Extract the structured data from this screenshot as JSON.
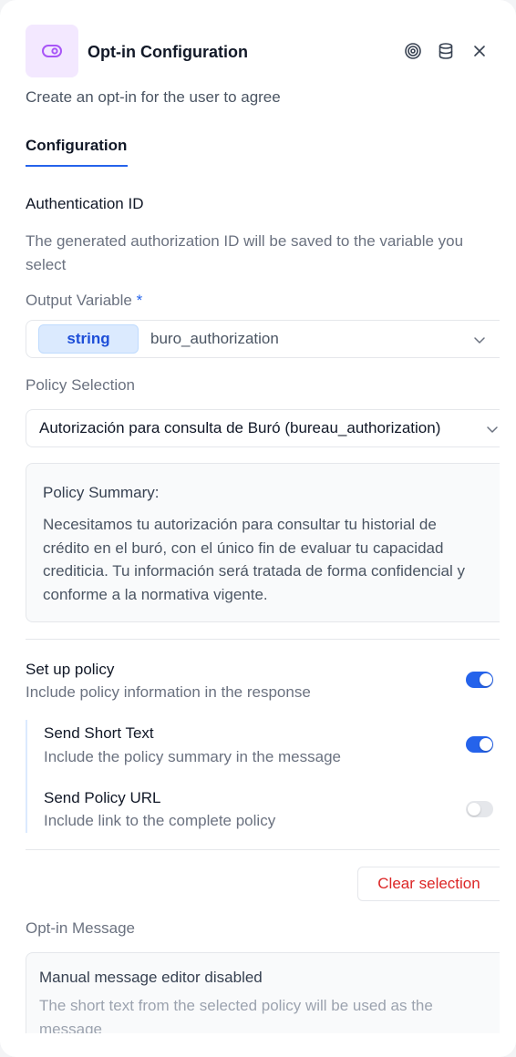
{
  "header": {
    "title": "Opt-in Configuration",
    "subtitle": "Create an opt-in for the user to agree",
    "icon": "toggle-icon",
    "accent": "#a855f7"
  },
  "tabs": [
    {
      "label": "Configuration",
      "active": true
    }
  ],
  "auth": {
    "title": "Authentication ID",
    "description": "The generated authorization ID will be saved to the variable you select",
    "output_label": "Output Variable",
    "required_mark": "*",
    "type_badge": "string",
    "variable": "buro_authorization"
  },
  "policy": {
    "label": "Policy Selection",
    "selected": "Autorización para consulta de Buró (bureau_authorization)",
    "summary_title": "Policy Summary:",
    "summary_text": "Necesitamos tu autorización para consultar tu historial de crédito en el buró, con el único fin de evaluar tu capacidad crediticia. Tu información será tratada de forma confidencial y conforme a la normativa vigente."
  },
  "setup": {
    "title": "Set up policy",
    "description": "Include policy information in the response",
    "enabled": true,
    "short_text": {
      "title": "Send Short Text",
      "description": "Include the policy summary in the message",
      "enabled": true
    },
    "policy_url": {
      "title": "Send Policy URL",
      "description": "Include link to the complete policy",
      "enabled": false
    }
  },
  "actions": {
    "clear_label": "Clear selection"
  },
  "message": {
    "label": "Opt-in Message",
    "disabled_title": "Manual message editor disabled",
    "disabled_text": "The short text from the selected policy will be used as the message"
  },
  "colors": {
    "primary": "#2563eb",
    "danger": "#dc2626",
    "icon_bg": "#f3e8ff"
  }
}
